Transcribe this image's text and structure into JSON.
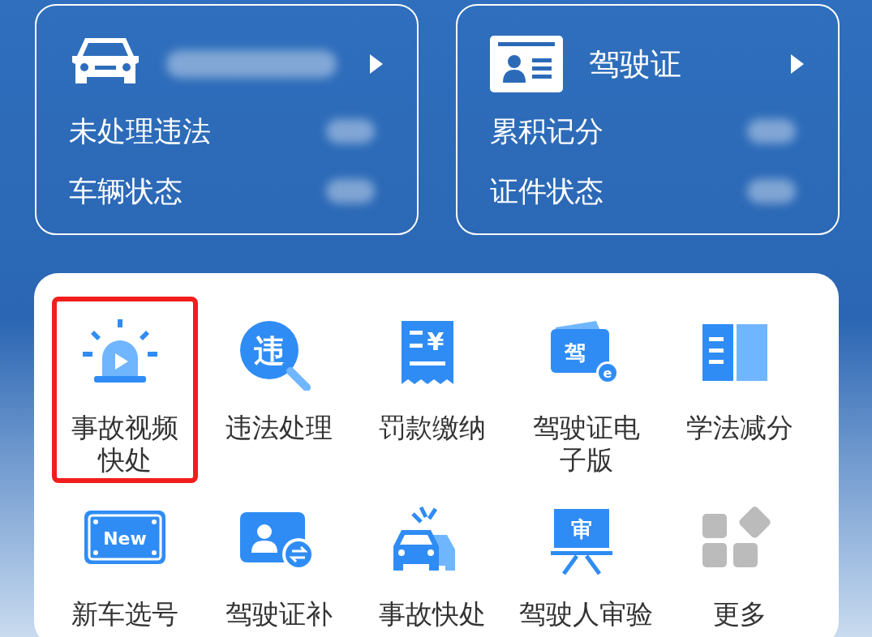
{
  "cards": [
    {
      "kind": "car",
      "title_redacted": true,
      "rows": [
        {
          "label": "未处理违法",
          "value_redacted": true
        },
        {
          "label": "车辆状态",
          "value_redacted": true
        }
      ]
    },
    {
      "kind": "license",
      "title": "驾驶证",
      "title_redacted": false,
      "rows": [
        {
          "label": "累积记分",
          "value_redacted": true
        },
        {
          "label": "证件状态",
          "value_redacted": true
        }
      ]
    }
  ],
  "services": [
    {
      "kind": "siren",
      "label": "事故视频快处",
      "highlighted": true
    },
    {
      "kind": "search",
      "icon_text": "违",
      "label": "违法处理",
      "highlighted": false
    },
    {
      "kind": "receipt",
      "icon_text": "¥",
      "label": "罚款缴纳",
      "highlighted": false
    },
    {
      "kind": "elicense",
      "icon_text": "驾",
      "badge_text": "e",
      "label": "驾驶证电子版",
      "highlighted": false
    },
    {
      "kind": "book",
      "label": "学法减分",
      "highlighted": false
    },
    {
      "kind": "newplate",
      "icon_text": "New",
      "label": "新车选号",
      "highlighted": false
    },
    {
      "kind": "idswap",
      "label": "驾驶证补",
      "highlighted": false
    },
    {
      "kind": "crash",
      "label": "事故快处",
      "highlighted": false
    },
    {
      "kind": "review",
      "icon_text": "审",
      "label": "驾驶人审验",
      "highlighted": false
    },
    {
      "kind": "more",
      "label": "更多",
      "highlighted": false
    }
  ]
}
